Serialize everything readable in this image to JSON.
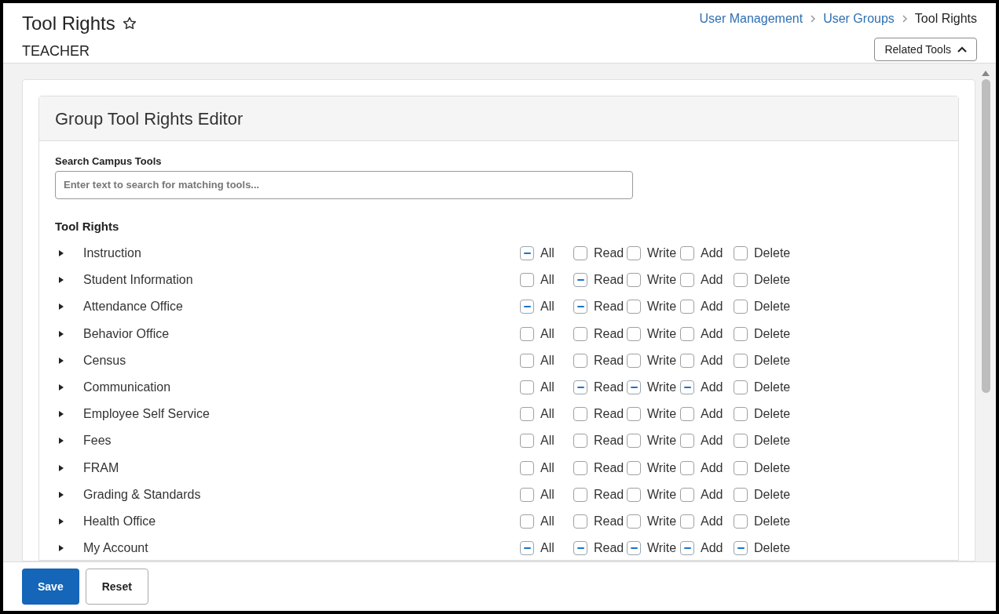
{
  "page": {
    "title": "Tool Rights",
    "subtitle": "TEACHER",
    "favorite": false
  },
  "breadcrumbs": [
    {
      "label": "User Management",
      "link": true
    },
    {
      "label": "User Groups",
      "link": true
    },
    {
      "label": "Tool Rights",
      "link": false
    }
  ],
  "related_tools": {
    "label": "Related Tools",
    "expanded": true
  },
  "editor": {
    "title": "Group Tool Rights Editor",
    "search": {
      "label": "Search Campus Tools",
      "placeholder": "Enter text to search for matching tools..."
    },
    "section_label": "Tool Rights",
    "tools": [
      {
        "name": "Instruction",
        "expanded": false,
        "rights": [
          {
            "label": "All",
            "partial": true
          },
          {
            "label": "Read",
            "partial": false
          },
          {
            "label": "Write",
            "partial": false
          },
          {
            "label": "Add",
            "partial": false
          },
          {
            "label": "Delete",
            "partial": false
          }
        ]
      },
      {
        "name": "Student Information",
        "expanded": false,
        "rights": [
          {
            "label": "All",
            "partial": false
          },
          {
            "label": "Read",
            "partial": true
          },
          {
            "label": "Write",
            "partial": false
          },
          {
            "label": "Add",
            "partial": false
          },
          {
            "label": "Delete",
            "partial": false
          }
        ]
      },
      {
        "name": "Attendance Office",
        "expanded": false,
        "rights": [
          {
            "label": "All",
            "partial": true
          },
          {
            "label": "Read",
            "partial": true
          },
          {
            "label": "Write",
            "partial": false
          },
          {
            "label": "Add",
            "partial": false
          },
          {
            "label": "Delete",
            "partial": false
          }
        ]
      },
      {
        "name": "Behavior Office",
        "expanded": false,
        "rights": [
          {
            "label": "All",
            "partial": false
          },
          {
            "label": "Read",
            "partial": false
          },
          {
            "label": "Write",
            "partial": false
          },
          {
            "label": "Add",
            "partial": false
          },
          {
            "label": "Delete",
            "partial": false
          }
        ]
      },
      {
        "name": "Census",
        "expanded": false,
        "rights": [
          {
            "label": "All",
            "partial": false
          },
          {
            "label": "Read",
            "partial": false
          },
          {
            "label": "Write",
            "partial": false
          },
          {
            "label": "Add",
            "partial": false
          },
          {
            "label": "Delete",
            "partial": false
          }
        ]
      },
      {
        "name": "Communication",
        "expanded": false,
        "rights": [
          {
            "label": "All",
            "partial": false
          },
          {
            "label": "Read",
            "partial": true
          },
          {
            "label": "Write",
            "partial": true
          },
          {
            "label": "Add",
            "partial": true
          },
          {
            "label": "Delete",
            "partial": false
          }
        ]
      },
      {
        "name": "Employee Self Service",
        "expanded": false,
        "rights": [
          {
            "label": "All",
            "partial": false
          },
          {
            "label": "Read",
            "partial": false
          },
          {
            "label": "Write",
            "partial": false
          },
          {
            "label": "Add",
            "partial": false
          },
          {
            "label": "Delete",
            "partial": false
          }
        ]
      },
      {
        "name": "Fees",
        "expanded": false,
        "rights": [
          {
            "label": "All",
            "partial": false
          },
          {
            "label": "Read",
            "partial": false
          },
          {
            "label": "Write",
            "partial": false
          },
          {
            "label": "Add",
            "partial": false
          },
          {
            "label": "Delete",
            "partial": false
          }
        ]
      },
      {
        "name": "FRAM",
        "expanded": false,
        "rights": [
          {
            "label": "All",
            "partial": false
          },
          {
            "label": "Read",
            "partial": false
          },
          {
            "label": "Write",
            "partial": false
          },
          {
            "label": "Add",
            "partial": false
          },
          {
            "label": "Delete",
            "partial": false
          }
        ]
      },
      {
        "name": "Grading & Standards",
        "expanded": false,
        "rights": [
          {
            "label": "All",
            "partial": false
          },
          {
            "label": "Read",
            "partial": false
          },
          {
            "label": "Write",
            "partial": false
          },
          {
            "label": "Add",
            "partial": false
          },
          {
            "label": "Delete",
            "partial": false
          }
        ]
      },
      {
        "name": "Health Office",
        "expanded": false,
        "rights": [
          {
            "label": "All",
            "partial": false
          },
          {
            "label": "Read",
            "partial": false
          },
          {
            "label": "Write",
            "partial": false
          },
          {
            "label": "Add",
            "partial": false
          },
          {
            "label": "Delete",
            "partial": false
          }
        ]
      },
      {
        "name": "My Account",
        "expanded": false,
        "rights": [
          {
            "label": "All",
            "partial": true
          },
          {
            "label": "Read",
            "partial": true
          },
          {
            "label": "Write",
            "partial": true
          },
          {
            "label": "Add",
            "partial": true
          },
          {
            "label": "Delete",
            "partial": true
          }
        ]
      }
    ]
  },
  "footer": {
    "buttons": [
      {
        "label": "Save",
        "kind": "primary"
      },
      {
        "label": "Reset",
        "kind": "secondary"
      }
    ]
  }
}
